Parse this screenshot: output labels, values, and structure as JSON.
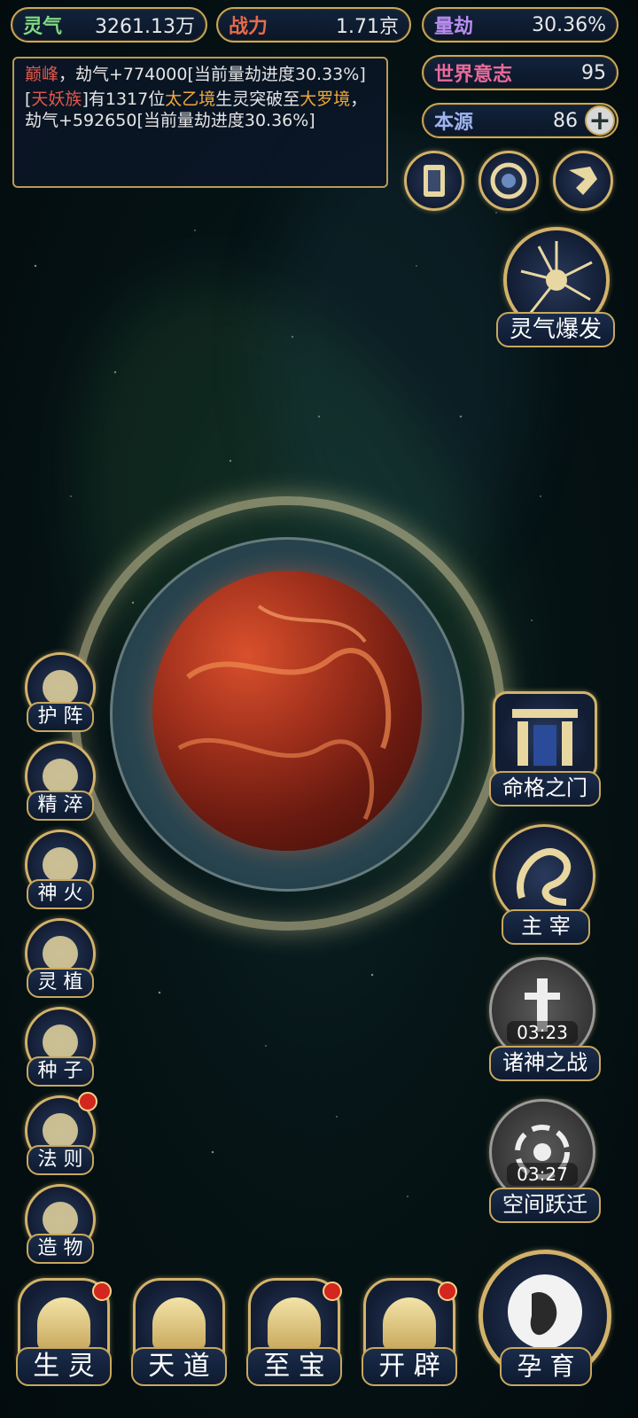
{
  "resources": {
    "lingqi": {
      "label": "灵气",
      "value": "3261.13万"
    },
    "zhanli": {
      "label": "战力",
      "value": "1.71京"
    },
    "liangjie": {
      "label": "量劫",
      "value": "30.36%"
    },
    "shijie": {
      "label": "世界意志",
      "value": "95"
    },
    "benyuan": {
      "label": "本源",
      "value": "86"
    }
  },
  "log": {
    "line1": {
      "name": "巅峰",
      "text": "，劫气+774000[当前量劫进度30.33%]"
    },
    "line2": {
      "prefix": "[",
      "race": "天妖族",
      "mid": "]有1317位",
      "realm1": "太乙境",
      "mid2": "生灵突破至",
      "realm2": "大罗境",
      "text": "，劫气+592650[当前量劫进度30.36%]"
    }
  },
  "top_icons": [
    "card-icon",
    "portal-icon",
    "scroll-icon"
  ],
  "burst": {
    "label": "灵气爆发"
  },
  "left_menu": [
    {
      "label": "护 阵",
      "icon": "yin-yang-icon",
      "badge": false
    },
    {
      "label": "精 淬",
      "icon": "lotus-icon",
      "badge": false
    },
    {
      "label": "神 火",
      "icon": "flame-icon",
      "badge": false
    },
    {
      "label": "灵 植",
      "icon": "plant-icon",
      "badge": false
    },
    {
      "label": "种 子",
      "icon": "flower-seed-icon",
      "badge": false
    },
    {
      "label": "法 则",
      "icon": "beast-icon",
      "badge": true
    },
    {
      "label": "造 物",
      "icon": "diamond-icon",
      "badge": false
    }
  ],
  "right_menu": {
    "gate": {
      "label": "命格之门"
    },
    "master": {
      "label": "主 宰"
    },
    "gods_war": {
      "label": "诸神之战",
      "timer": "03:23"
    },
    "space_jump": {
      "label": "空间跃迁",
      "timer": "03:27"
    }
  },
  "bottom_menu": [
    {
      "label": "生 灵",
      "badge": true
    },
    {
      "label": "天 道",
      "badge": false
    },
    {
      "label": "至 宝",
      "badge": true
    },
    {
      "label": "开 辟",
      "badge": true
    }
  ],
  "breed": {
    "label": "孕 育"
  },
  "colors": {
    "gold": "#c8a85c",
    "planet": "#8a2a1a",
    "badge": "#d3261e"
  }
}
